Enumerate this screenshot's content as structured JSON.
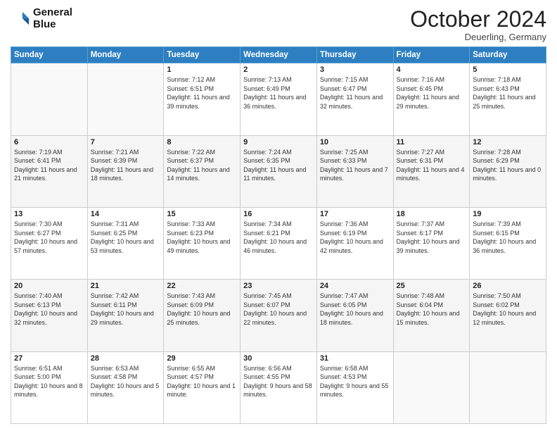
{
  "logo": {
    "line1": "General",
    "line2": "Blue"
  },
  "header": {
    "month": "October 2024",
    "location": "Deuerling, Germany"
  },
  "weekdays": [
    "Sunday",
    "Monday",
    "Tuesday",
    "Wednesday",
    "Thursday",
    "Friday",
    "Saturday"
  ],
  "weeks": [
    [
      {
        "day": "",
        "info": ""
      },
      {
        "day": "",
        "info": ""
      },
      {
        "day": "1",
        "info": "Sunrise: 7:12 AM\nSunset: 6:51 PM\nDaylight: 11 hours and 39 minutes."
      },
      {
        "day": "2",
        "info": "Sunrise: 7:13 AM\nSunset: 6:49 PM\nDaylight: 11 hours and 36 minutes."
      },
      {
        "day": "3",
        "info": "Sunrise: 7:15 AM\nSunset: 6:47 PM\nDaylight: 11 hours and 32 minutes."
      },
      {
        "day": "4",
        "info": "Sunrise: 7:16 AM\nSunset: 6:45 PM\nDaylight: 11 hours and 29 minutes."
      },
      {
        "day": "5",
        "info": "Sunrise: 7:18 AM\nSunset: 6:43 PM\nDaylight: 11 hours and 25 minutes."
      }
    ],
    [
      {
        "day": "6",
        "info": "Sunrise: 7:19 AM\nSunset: 6:41 PM\nDaylight: 11 hours and 21 minutes."
      },
      {
        "day": "7",
        "info": "Sunrise: 7:21 AM\nSunset: 6:39 PM\nDaylight: 11 hours and 18 minutes."
      },
      {
        "day": "8",
        "info": "Sunrise: 7:22 AM\nSunset: 6:37 PM\nDaylight: 11 hours and 14 minutes."
      },
      {
        "day": "9",
        "info": "Sunrise: 7:24 AM\nSunset: 6:35 PM\nDaylight: 11 hours and 11 minutes."
      },
      {
        "day": "10",
        "info": "Sunrise: 7:25 AM\nSunset: 6:33 PM\nDaylight: 11 hours and 7 minutes."
      },
      {
        "day": "11",
        "info": "Sunrise: 7:27 AM\nSunset: 6:31 PM\nDaylight: 11 hours and 4 minutes."
      },
      {
        "day": "12",
        "info": "Sunrise: 7:28 AM\nSunset: 6:29 PM\nDaylight: 11 hours and 0 minutes."
      }
    ],
    [
      {
        "day": "13",
        "info": "Sunrise: 7:30 AM\nSunset: 6:27 PM\nDaylight: 10 hours and 57 minutes."
      },
      {
        "day": "14",
        "info": "Sunrise: 7:31 AM\nSunset: 6:25 PM\nDaylight: 10 hours and 53 minutes."
      },
      {
        "day": "15",
        "info": "Sunrise: 7:33 AM\nSunset: 6:23 PM\nDaylight: 10 hours and 49 minutes."
      },
      {
        "day": "16",
        "info": "Sunrise: 7:34 AM\nSunset: 6:21 PM\nDaylight: 10 hours and 46 minutes."
      },
      {
        "day": "17",
        "info": "Sunrise: 7:36 AM\nSunset: 6:19 PM\nDaylight: 10 hours and 42 minutes."
      },
      {
        "day": "18",
        "info": "Sunrise: 7:37 AM\nSunset: 6:17 PM\nDaylight: 10 hours and 39 minutes."
      },
      {
        "day": "19",
        "info": "Sunrise: 7:39 AM\nSunset: 6:15 PM\nDaylight: 10 hours and 36 minutes."
      }
    ],
    [
      {
        "day": "20",
        "info": "Sunrise: 7:40 AM\nSunset: 6:13 PM\nDaylight: 10 hours and 32 minutes."
      },
      {
        "day": "21",
        "info": "Sunrise: 7:42 AM\nSunset: 6:11 PM\nDaylight: 10 hours and 29 minutes."
      },
      {
        "day": "22",
        "info": "Sunrise: 7:43 AM\nSunset: 6:09 PM\nDaylight: 10 hours and 25 minutes."
      },
      {
        "day": "23",
        "info": "Sunrise: 7:45 AM\nSunset: 6:07 PM\nDaylight: 10 hours and 22 minutes."
      },
      {
        "day": "24",
        "info": "Sunrise: 7:47 AM\nSunset: 6:05 PM\nDaylight: 10 hours and 18 minutes."
      },
      {
        "day": "25",
        "info": "Sunrise: 7:48 AM\nSunset: 6:04 PM\nDaylight: 10 hours and 15 minutes."
      },
      {
        "day": "26",
        "info": "Sunrise: 7:50 AM\nSunset: 6:02 PM\nDaylight: 10 hours and 12 minutes."
      }
    ],
    [
      {
        "day": "27",
        "info": "Sunrise: 6:51 AM\nSunset: 5:00 PM\nDaylight: 10 hours and 8 minutes."
      },
      {
        "day": "28",
        "info": "Sunrise: 6:53 AM\nSunset: 4:58 PM\nDaylight: 10 hours and 5 minutes."
      },
      {
        "day": "29",
        "info": "Sunrise: 6:55 AM\nSunset: 4:57 PM\nDaylight: 10 hours and 1 minute."
      },
      {
        "day": "30",
        "info": "Sunrise: 6:56 AM\nSunset: 4:55 PM\nDaylight: 9 hours and 58 minutes."
      },
      {
        "day": "31",
        "info": "Sunrise: 6:58 AM\nSunset: 4:53 PM\nDaylight: 9 hours and 55 minutes."
      },
      {
        "day": "",
        "info": ""
      },
      {
        "day": "",
        "info": ""
      }
    ]
  ]
}
